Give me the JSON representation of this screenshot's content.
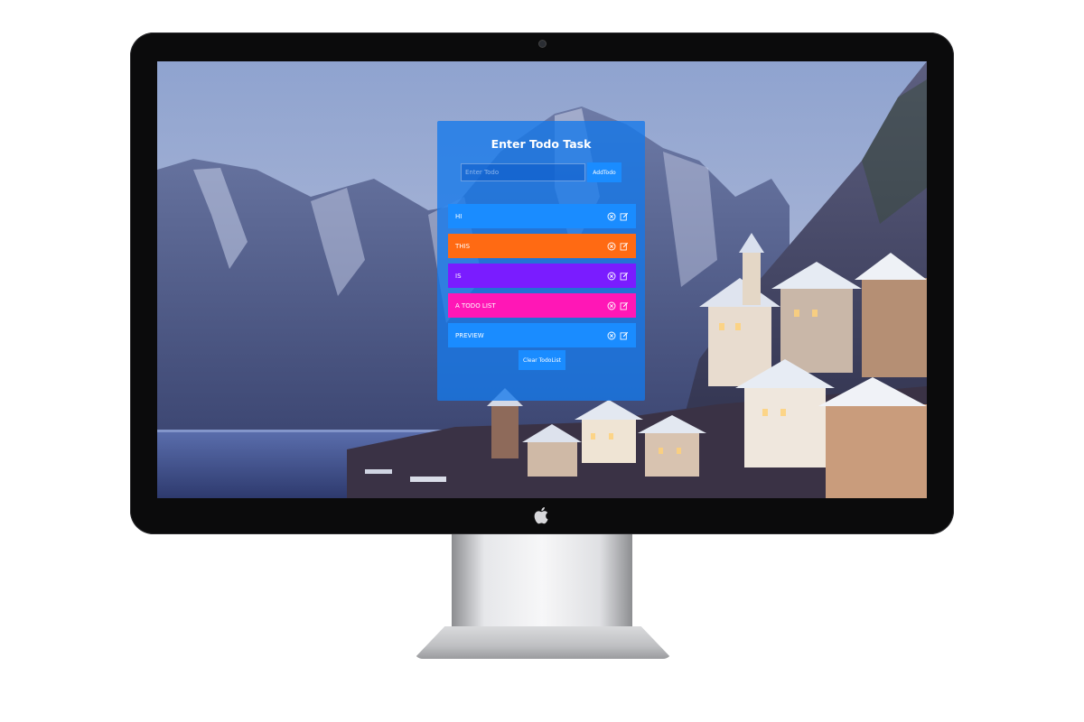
{
  "todo_app": {
    "title": "Enter Todo Task",
    "input": {
      "placeholder": "Enter Todo",
      "value": ""
    },
    "add_button_label": "AddTodo",
    "clear_button_label": "Clear TodoList",
    "items": [
      {
        "label": "HI",
        "color": "#1a8cff"
      },
      {
        "label": "THIS",
        "color": "#ff6a13"
      },
      {
        "label": "IS",
        "color": "#7a1cff"
      },
      {
        "label": "A TODO LIST",
        "color": "#ff17b6"
      },
      {
        "label": "PREVIEW",
        "color": "#1a8cff"
      }
    ],
    "item_icons": [
      "delete-circle-icon",
      "edit-icon"
    ]
  },
  "colors": {
    "card_bg": "#1478eb",
    "button": "#1a8cff",
    "bezel": "#0b0b0c"
  }
}
